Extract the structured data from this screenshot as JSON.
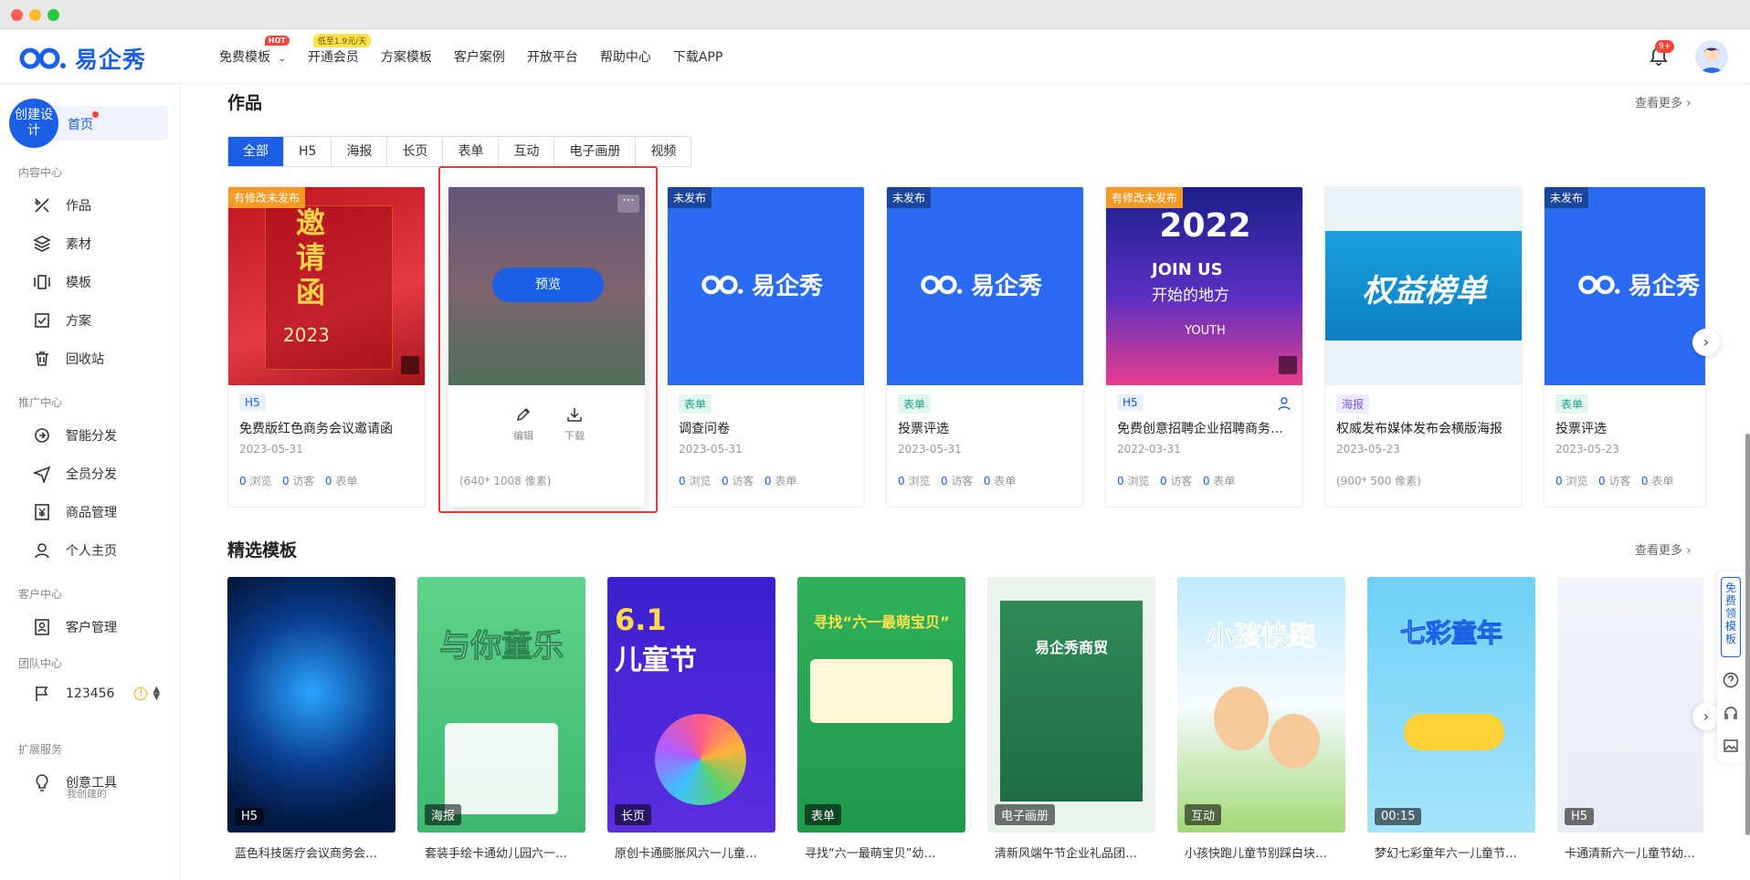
{
  "header": {
    "logo_text": "易企秀",
    "nav": [
      {
        "label": "免费模板",
        "badge": "HOT"
      },
      {
        "label": "开通会员",
        "badge": "低至1.9元/天"
      },
      {
        "label": "方案模板"
      },
      {
        "label": "客户案例"
      },
      {
        "label": "开放平台"
      },
      {
        "label": "帮助中心"
      },
      {
        "label": "下载APP"
      }
    ],
    "notif_count": "9+"
  },
  "sidebar": {
    "create_label": "创建设计",
    "home_label": "首页",
    "sections": [
      {
        "title": "内容中心",
        "items": [
          "作品",
          "素材",
          "模板",
          "方案",
          "回收站"
        ]
      },
      {
        "title": "推广中心",
        "items": [
          "智能分发",
          "全员分发",
          "商品管理",
          "个人主页"
        ]
      },
      {
        "title": "客户中心",
        "items": [
          "客户管理"
        ]
      },
      {
        "title": "团队中心",
        "items": [
          "123456"
        ]
      },
      {
        "title": "扩展服务",
        "items": [
          "创意工具"
        ]
      }
    ],
    "team_sub": "我创建的"
  },
  "works": {
    "title": "作品",
    "more": "查看更多",
    "tabs": [
      "全部",
      "H5",
      "海报",
      "长页",
      "表单",
      "互动",
      "电子画册",
      "视频"
    ],
    "cards": [
      {
        "ribbon": "有修改未发布",
        "tag": "H5",
        "title": "免费版红色商务会议邀请函",
        "date": "2023-05-31",
        "views": "0",
        "visitors": "0",
        "forms": "0",
        "thumb_title": "邀请函",
        "thumb_year": "2023"
      },
      {
        "preview": "预览",
        "edit": "编辑",
        "download": "下载",
        "size": "(640* 1008 像素)"
      },
      {
        "ribbon": "未发布",
        "tag": "表单",
        "title": "调查问卷",
        "date": "2023-05-31",
        "views": "0",
        "visitors": "0",
        "forms": "0",
        "logo": "易企秀"
      },
      {
        "ribbon": "未发布",
        "tag": "表单",
        "title": "投票评选",
        "date": "2023-05-31",
        "views": "0",
        "visitors": "0",
        "forms": "0",
        "logo": "易企秀"
      },
      {
        "ribbon": "有修改未发布",
        "tag": "H5",
        "title": "免费创意招聘企业招聘商务…",
        "date": "2022-03-31",
        "views": "0",
        "visitors": "0",
        "forms": "0",
        "thumb_year": "2022",
        "thumb_text": "JOIN US",
        "thumb_sub": "开始的地方",
        "thumb_youth": "YOUTH"
      },
      {
        "tag": "海报",
        "title": "权威发布媒体发布会横版海报",
        "date": "2023-05-23",
        "size": "(900* 500 像素)",
        "thumb_text": "权益榜单"
      },
      {
        "ribbon": "未发布",
        "tag": "表单",
        "title": "投票评选",
        "date": "2023-05-23",
        "views": "0",
        "visitors": "0",
        "forms": "0",
        "logo": "易企秀"
      }
    ],
    "stat_labels": {
      "views": "浏览",
      "visitors": "访客",
      "forms": "表单"
    }
  },
  "templates": {
    "title": "精选模板",
    "more": "查看更多",
    "items": [
      {
        "tag": "H5",
        "title": "蓝色科技医疗会议商务会…"
      },
      {
        "tag": "海报",
        "title": "套装手绘卡通幼儿园六一…",
        "thumb_text": "与你童乐"
      },
      {
        "tag": "长页",
        "title": "原创卡通膨胀风六一儿童…",
        "thumb_text": "儿童节",
        "thumb_num": "6.1"
      },
      {
        "tag": "表单",
        "title": "寻找“六一最萌宝贝”幼…",
        "thumb_text": "寻找“六一最萌宝贝”"
      },
      {
        "tag": "电子画册",
        "title": "清新风端午节企业礼品团…",
        "thumb_text": "易企秀商贸"
      },
      {
        "tag": "互动",
        "title": "小孩快跑儿童节别踩白块…",
        "thumb_text": "小孩快跑"
      },
      {
        "tag": "00:15",
        "title": "梦幻七彩童年六一儿童节…",
        "thumb_text": "七彩童年"
      },
      {
        "tag": "H5",
        "title": "卡通清新六一儿童节幼儿…"
      }
    ]
  },
  "float_bar": {
    "free_template": "免费领模板"
  },
  "colors": {
    "brand": "#1a5fe6",
    "orange_ribbon": "#f59a23",
    "highlight": "#e53935"
  }
}
